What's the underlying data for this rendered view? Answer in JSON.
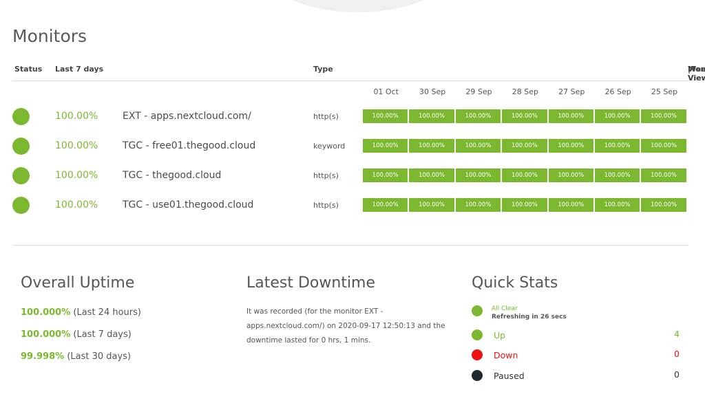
{
  "page": {
    "title": "Monitors"
  },
  "table_header": {
    "status": "Status",
    "last7": "Last 7 days",
    "type": "Type",
    "weekly_view": "Weekly View",
    "separator": "|",
    "monthly_view": "Monthly View"
  },
  "dates": [
    "01 Oct",
    "30 Sep",
    "29 Sep",
    "28 Sep",
    "27 Sep",
    "26 Sep",
    "25 Sep"
  ],
  "monitors": [
    {
      "uptime": "100.00%",
      "name": "EXT - apps.nextcloud.com/",
      "type": "http(s)",
      "days": [
        "100.00%",
        "100.00%",
        "100.00%",
        "100.00%",
        "100.00%",
        "100.00%",
        "100.00%"
      ]
    },
    {
      "uptime": "100.00%",
      "name": "TGC - free01.thegood.cloud",
      "type": "keyword",
      "days": [
        "100.00%",
        "100.00%",
        "100.00%",
        "100.00%",
        "100.00%",
        "100.00%",
        "100.00%"
      ]
    },
    {
      "uptime": "100.00%",
      "name": "TGC - thegood.cloud",
      "type": "http(s)",
      "days": [
        "100.00%",
        "100.00%",
        "100.00%",
        "100.00%",
        "100.00%",
        "100.00%",
        "100.00%"
      ]
    },
    {
      "uptime": "100.00%",
      "name": "TGC - use01.thegood.cloud",
      "type": "http(s)",
      "days": [
        "100.00%",
        "100.00%",
        "100.00%",
        "100.00%",
        "100.00%",
        "100.00%",
        "100.00%"
      ]
    }
  ],
  "overall_uptime": {
    "title": "Overall Uptime",
    "lines": [
      {
        "value": "100.000%",
        "period": "(Last 24 hours)"
      },
      {
        "value": "100.000%",
        "period": "(Last 7 days)"
      },
      {
        "value": "99.998%",
        "period": "(Last 30 days)"
      }
    ]
  },
  "latest_downtime": {
    "title": "Latest Downtime",
    "text": "It was recorded (for the monitor EXT - apps.nextcloud.com/) on 2020-09-17 12:50:13 and the downtime lasted for 0 hrs, 1 mins."
  },
  "quick_stats": {
    "title": "Quick Stats",
    "all_clear": "All Clear",
    "refreshing": "Refreshing in 26 secs",
    "up_label": "Up",
    "up_count": "4",
    "down_label": "Down",
    "down_count": "0",
    "paused_label": "Paused",
    "paused_count": "0"
  },
  "colors": {
    "green": "#7cb82f",
    "red": "#ee1111",
    "dark": "#1f2a30"
  }
}
